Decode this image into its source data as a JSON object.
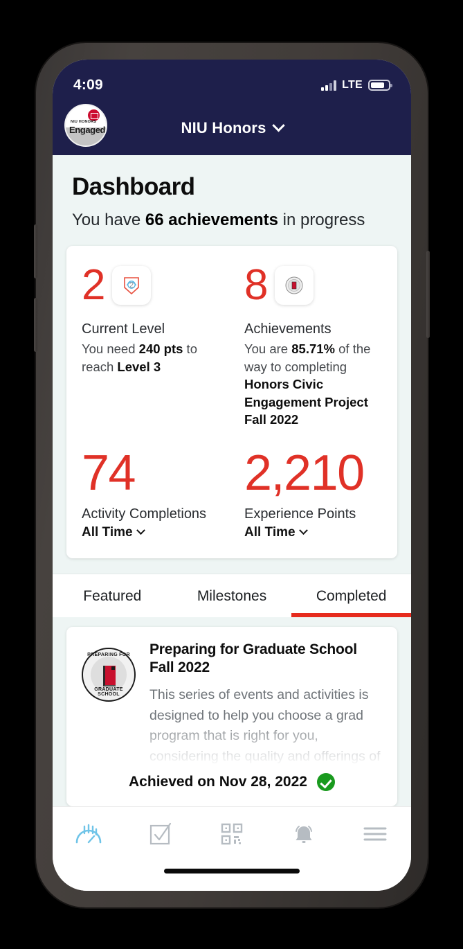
{
  "status_bar": {
    "time": "4:09",
    "network_label": "LTE",
    "signal_icon": "cellular-signal-icon",
    "battery_icon": "battery-icon"
  },
  "app_bar": {
    "title": "NIU Honors",
    "chevron_icon": "chevron-down-icon",
    "logo": {
      "name": "niu-honors-engaged-logo",
      "line1": "NIU HONORS",
      "line2": "Engaged"
    }
  },
  "page": {
    "title": "Dashboard",
    "subtitle_prefix": "You have ",
    "subtitle_bold": "66 achievements",
    "subtitle_suffix": " in progress",
    "achievements_in_progress": 66
  },
  "stats": {
    "current_level": {
      "value": "2",
      "label": "Current Level",
      "desc_prefix": "You need ",
      "desc_bold": "240 pts",
      "desc_mid": " to reach ",
      "desc_bold2": "Level 3",
      "points_needed": 240,
      "next_level": 3,
      "badge_icon": "level-shield-badge-icon"
    },
    "achievements": {
      "value": "8",
      "label": "Achievements",
      "desc_prefix": "You are ",
      "desc_bold": "85.71%",
      "desc_mid": " of the way to completing ",
      "desc_bold2": "Honors Civic Engagement Project Fall 2022",
      "percent": 85.71,
      "badge_icon": "achievement-seal-badge-icon"
    },
    "activity_completions": {
      "value": "74",
      "label": "Activity Completions",
      "range": "All Time",
      "chevron_icon": "chevron-down-icon"
    },
    "experience_points": {
      "value": "2,210",
      "label": "Experience Points",
      "range": "All Time",
      "chevron_icon": "chevron-down-icon"
    }
  },
  "tabs": [
    {
      "label": "Featured",
      "active": false
    },
    {
      "label": "Milestones",
      "active": false
    },
    {
      "label": "Completed",
      "active": true
    }
  ],
  "achievement_card": {
    "seal": {
      "name": "preparing-for-graduate-school-seal",
      "arc_top": "PREPARING FOR",
      "arc_bottom": "GRADUATE SCHOOL",
      "inner_icon": "book-icon"
    },
    "title": "Preparing for Graduate School Fall 2022",
    "description": "This series of events and activities is designed to help you choose a grad program that is right for you, considering the quality and offerings of the program as well as factoring in",
    "achieved_text": "Achieved on Nov 28, 2022",
    "achieved_icon": "green-check-circle-icon"
  },
  "bottom_nav": [
    {
      "icon": "dashboard-gauge-icon",
      "active": true
    },
    {
      "icon": "checkbox-icon",
      "active": false
    },
    {
      "icon": "qr-code-icon",
      "active": false
    },
    {
      "icon": "bell-notification-icon",
      "active": false
    },
    {
      "icon": "hamburger-menu-icon",
      "active": false
    }
  ],
  "colors": {
    "accent_red": "#e03127",
    "tab_indicator_red": "#e62b1e",
    "navy": "#1e1f4b",
    "page_bg": "#eef5f4",
    "nav_active_blue": "#6fc4e8",
    "nav_inactive_gray": "#b6bcc2",
    "success_green": "#199a1e"
  }
}
